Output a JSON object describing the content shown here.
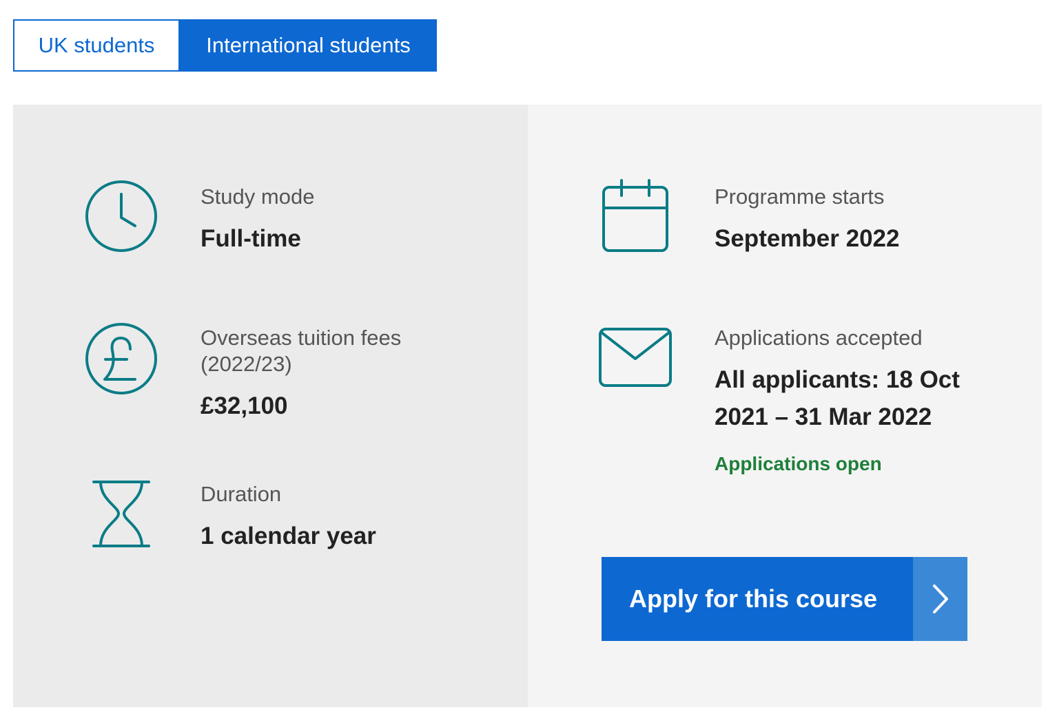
{
  "tabs": {
    "uk_label": "UK students",
    "international_label": "International students",
    "selected": "International students"
  },
  "details": {
    "study_mode": {
      "label": "Study mode",
      "value": "Full-time",
      "icon": "clock-icon"
    },
    "fees": {
      "label_line1": "Overseas tuition fees",
      "label_line2": "(2022/23)",
      "value": "£32,100",
      "icon": "pound-icon"
    },
    "duration": {
      "label": "Duration",
      "value": "1 calendar year",
      "icon": "hourglass-icon"
    },
    "programme_starts": {
      "label": "Programme starts",
      "value": "September 2022",
      "icon": "calendar-icon"
    },
    "applications": {
      "label": "Applications accepted",
      "value_line1": "All applicants: 18 Oct",
      "value_line2": "2021 – 31 Mar 2022",
      "status": "Applications open",
      "icon": "envelope-icon"
    }
  },
  "apply_button": {
    "label": "Apply for this course",
    "icon": "chevron-right-icon"
  },
  "colors": {
    "primary_blue": "#0d68d1",
    "arrow_blue": "#3a88d6",
    "icon_teal": "#0b7c86",
    "status_green": "#1f7f3a",
    "panel_left_bg": "#ebebeb",
    "panel_right_bg": "#f4f4f4"
  }
}
